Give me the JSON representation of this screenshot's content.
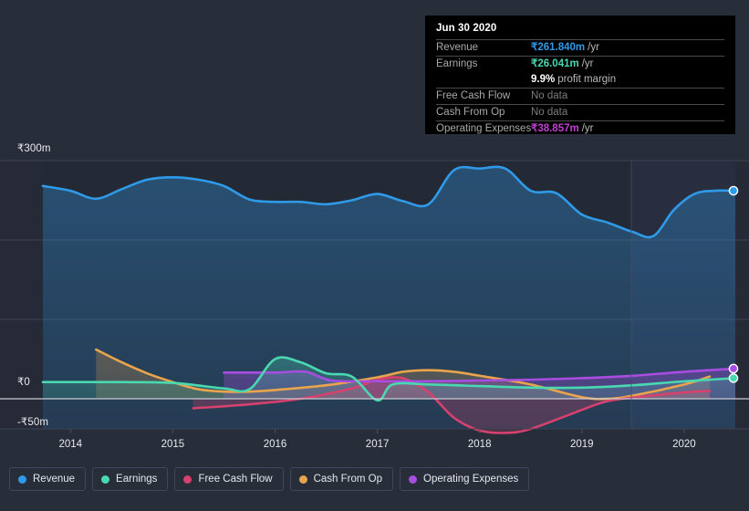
{
  "chart_data": {
    "type": "area",
    "title": "",
    "xlabel": "",
    "ylabel": "",
    "currency": "₹",
    "ylim": [
      -50,
      300
    ],
    "ytick_labels": [
      "₹300m",
      "₹0",
      "-₹50m"
    ],
    "ytick_values": [
      300,
      0,
      -50
    ],
    "xtick_labels": [
      "2014",
      "2015",
      "2016",
      "2017",
      "2018",
      "2019",
      "2020"
    ],
    "xtick_values": [
      2014,
      2015,
      2016,
      2017,
      2018,
      2019,
      2020
    ],
    "grid": true,
    "legend_position": "bottom-left",
    "series": [
      {
        "name": "Revenue",
        "color": "#2f9be8",
        "points": [
          {
            "x": 2013.73,
            "y": 268
          },
          {
            "x": 2014.0,
            "y": 262
          },
          {
            "x": 2014.25,
            "y": 252
          },
          {
            "x": 2014.5,
            "y": 264
          },
          {
            "x": 2014.75,
            "y": 276
          },
          {
            "x": 2015.0,
            "y": 279
          },
          {
            "x": 2015.25,
            "y": 276
          },
          {
            "x": 2015.5,
            "y": 268
          },
          {
            "x": 2015.75,
            "y": 251
          },
          {
            "x": 2016.0,
            "y": 248
          },
          {
            "x": 2016.25,
            "y": 248
          },
          {
            "x": 2016.5,
            "y": 245
          },
          {
            "x": 2016.75,
            "y": 250
          },
          {
            "x": 2017.0,
            "y": 258
          },
          {
            "x": 2017.25,
            "y": 249
          },
          {
            "x": 2017.5,
            "y": 245
          },
          {
            "x": 2017.75,
            "y": 288
          },
          {
            "x": 2018.0,
            "y": 290
          },
          {
            "x": 2018.25,
            "y": 290
          },
          {
            "x": 2018.5,
            "y": 262
          },
          {
            "x": 2018.75,
            "y": 259
          },
          {
            "x": 2019.0,
            "y": 232
          },
          {
            "x": 2019.25,
            "y": 222
          },
          {
            "x": 2019.5,
            "y": 210
          },
          {
            "x": 2019.7,
            "y": 205
          },
          {
            "x": 2019.9,
            "y": 238
          },
          {
            "x": 2020.1,
            "y": 258
          },
          {
            "x": 2020.3,
            "y": 262
          },
          {
            "x": 2020.5,
            "y": 262
          }
        ],
        "end_value": 261.84
      },
      {
        "name": "Earnings",
        "color": "#4ad8b0",
        "points": [
          {
            "x": 2013.73,
            "y": 21
          },
          {
            "x": 2014.5,
            "y": 21
          },
          {
            "x": 2015.0,
            "y": 20
          },
          {
            "x": 2015.5,
            "y": 13
          },
          {
            "x": 2015.75,
            "y": 12
          },
          {
            "x": 2016.0,
            "y": 50
          },
          {
            "x": 2016.25,
            "y": 46
          },
          {
            "x": 2016.5,
            "y": 32
          },
          {
            "x": 2016.75,
            "y": 28
          },
          {
            "x": 2017.0,
            "y": -2
          },
          {
            "x": 2017.15,
            "y": 18
          },
          {
            "x": 2017.5,
            "y": 18
          },
          {
            "x": 2018.0,
            "y": 16
          },
          {
            "x": 2018.5,
            "y": 14
          },
          {
            "x": 2019.0,
            "y": 14
          },
          {
            "x": 2019.5,
            "y": 17
          },
          {
            "x": 2020.0,
            "y": 22
          },
          {
            "x": 2020.5,
            "y": 26
          }
        ],
        "end_value": 26.041
      },
      {
        "name": "Free Cash Flow",
        "color": "#d6416e",
        "points": [
          {
            "x": 2015.2,
            "y": -12
          },
          {
            "x": 2015.75,
            "y": -7
          },
          {
            "x": 2016.25,
            "y": 0
          },
          {
            "x": 2016.75,
            "y": 13
          },
          {
            "x": 2017.0,
            "y": 24
          },
          {
            "x": 2017.25,
            "y": 26
          },
          {
            "x": 2017.5,
            "y": 8
          },
          {
            "x": 2017.75,
            "y": -24
          },
          {
            "x": 2018.0,
            "y": -40
          },
          {
            "x": 2018.25,
            "y": -43
          },
          {
            "x": 2018.5,
            "y": -38
          },
          {
            "x": 2019.0,
            "y": -14
          },
          {
            "x": 2019.25,
            "y": -3
          },
          {
            "x": 2019.6,
            "y": 3
          },
          {
            "x": 2020.0,
            "y": 8
          },
          {
            "x": 2020.25,
            "y": 10
          }
        ],
        "end_value": null
      },
      {
        "name": "Cash From Op",
        "color": "#eaa44c",
        "points": [
          {
            "x": 2014.25,
            "y": 62
          },
          {
            "x": 2014.5,
            "y": 46
          },
          {
            "x": 2014.75,
            "y": 32
          },
          {
            "x": 2015.0,
            "y": 21
          },
          {
            "x": 2015.25,
            "y": 12
          },
          {
            "x": 2015.5,
            "y": 9
          },
          {
            "x": 2015.75,
            "y": 9
          },
          {
            "x": 2016.0,
            "y": 11
          },
          {
            "x": 2016.5,
            "y": 17
          },
          {
            "x": 2017.0,
            "y": 27
          },
          {
            "x": 2017.25,
            "y": 34
          },
          {
            "x": 2017.5,
            "y": 36
          },
          {
            "x": 2017.75,
            "y": 34
          },
          {
            "x": 2018.0,
            "y": 29
          },
          {
            "x": 2018.5,
            "y": 18
          },
          {
            "x": 2019.0,
            "y": 2
          },
          {
            "x": 2019.25,
            "y": 0
          },
          {
            "x": 2019.5,
            "y": 4
          },
          {
            "x": 2020.0,
            "y": 18
          },
          {
            "x": 2020.25,
            "y": 28
          }
        ],
        "end_value": null
      },
      {
        "name": "Operating Expenses",
        "color": "#a84de0",
        "points": [
          {
            "x": 2015.5,
            "y": 33
          },
          {
            "x": 2016.0,
            "y": 33
          },
          {
            "x": 2016.3,
            "y": 34
          },
          {
            "x": 2016.55,
            "y": 23
          },
          {
            "x": 2017.0,
            "y": 22
          },
          {
            "x": 2017.5,
            "y": 22
          },
          {
            "x": 2018.0,
            "y": 23
          },
          {
            "x": 2018.5,
            "y": 24
          },
          {
            "x": 2019.0,
            "y": 26
          },
          {
            "x": 2019.5,
            "y": 29
          },
          {
            "x": 2020.0,
            "y": 34
          },
          {
            "x": 2020.5,
            "y": 38
          }
        ],
        "end_value": 38.857
      }
    ]
  },
  "tooltip": {
    "date": "Jun 30 2020",
    "rows": [
      {
        "label": "Revenue",
        "value": "₹261.840m",
        "unit": "/yr",
        "color": "#2f9be8",
        "no_data": false
      },
      {
        "label": "Earnings",
        "value": "₹26.041m",
        "unit": "/yr",
        "color": "#4ad8b0",
        "no_data": false
      },
      {
        "label": "",
        "value": "9.9%",
        "unit": "profit margin",
        "color": "#ffffff",
        "no_data": false
      },
      {
        "label": "Free Cash Flow",
        "value": "No data",
        "unit": "",
        "color": "#7c7c7c",
        "no_data": true
      },
      {
        "label": "Cash From Op",
        "value": "No data",
        "unit": "",
        "color": "#7c7c7c",
        "no_data": true
      },
      {
        "label": "Operating Expenses",
        "value": "₹38.857m",
        "unit": "/yr",
        "color": "#c040d0",
        "no_data": false
      }
    ]
  },
  "legend": {
    "items": [
      {
        "label": "Revenue",
        "color": "#2f9be8"
      },
      {
        "label": "Earnings",
        "color": "#4ad8b0"
      },
      {
        "label": "Free Cash Flow",
        "color": "#d6416e"
      },
      {
        "label": "Cash From Op",
        "color": "#eaa44c"
      },
      {
        "label": "Operating Expenses",
        "color": "#a84de0"
      }
    ]
  },
  "axes": {
    "y_labels": [
      "₹300m",
      "₹0",
      "-₹50m"
    ],
    "x_labels": [
      "2014",
      "2015",
      "2016",
      "2017",
      "2018",
      "2019",
      "2020"
    ]
  },
  "theme": {
    "background": "#282d3a",
    "grid": "#3c4252",
    "axis_text": "#e8eaee",
    "tooltip_bg": "#000000"
  }
}
